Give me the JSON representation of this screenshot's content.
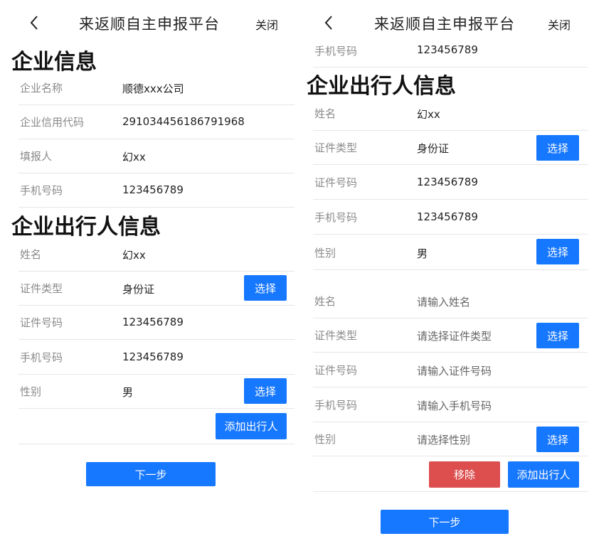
{
  "nav": {
    "title": "来返顺自主申报平台",
    "close": "关闭"
  },
  "left": {
    "company_title": "企业信息",
    "company": {
      "name": {
        "label": "企业名称",
        "value": "顺德xxx公司"
      },
      "credit": {
        "label": "企业信用代码",
        "value": "291034456186791968"
      },
      "filler": {
        "label": "填报人",
        "value": "幻xx"
      },
      "phone": {
        "label": "手机号码",
        "value": "123456789"
      }
    },
    "traveler_title": "企业出行人信息",
    "traveler": {
      "name": {
        "label": "姓名",
        "value": "幻xx"
      },
      "id_type": {
        "label": "证件类型",
        "value": "身份证"
      },
      "id_no": {
        "label": "证件号码",
        "value": "123456789"
      },
      "phone": {
        "label": "手机号码",
        "value": "123456789"
      },
      "gender": {
        "label": "性别",
        "value": "男"
      }
    },
    "select_label": "选择",
    "add_label": "添加出行人",
    "next_label": "下一步"
  },
  "right": {
    "top_phone": {
      "label": "手机号码",
      "value": "123456789"
    },
    "traveler_title": "企业出行人信息",
    "traveler1": {
      "name": {
        "label": "姓名",
        "value": "幻xx"
      },
      "id_type": {
        "label": "证件类型",
        "value": "身份证"
      },
      "id_no": {
        "label": "证件号码",
        "value": "123456789"
      },
      "phone": {
        "label": "手机号码",
        "value": "123456789"
      },
      "gender": {
        "label": "性别",
        "value": "男"
      }
    },
    "traveler2": {
      "name": {
        "label": "姓名",
        "placeholder": "请输入姓名"
      },
      "id_type": {
        "label": "证件类型",
        "placeholder": "请选择证件类型"
      },
      "id_no": {
        "label": "证件号码",
        "placeholder": "请输入证件号码"
      },
      "phone": {
        "label": "手机号码",
        "placeholder": "请输入手机号码"
      },
      "gender": {
        "label": "性别",
        "placeholder": "请选择性别"
      }
    },
    "select_label": "选择",
    "remove_label": "移除",
    "add_label": "添加出行人",
    "next_label": "下一步"
  },
  "colors": {
    "primary": "#1677ff",
    "danger": "#dd4e4e",
    "divider": "#e6e6e6",
    "label": "#8a8a8a"
  }
}
